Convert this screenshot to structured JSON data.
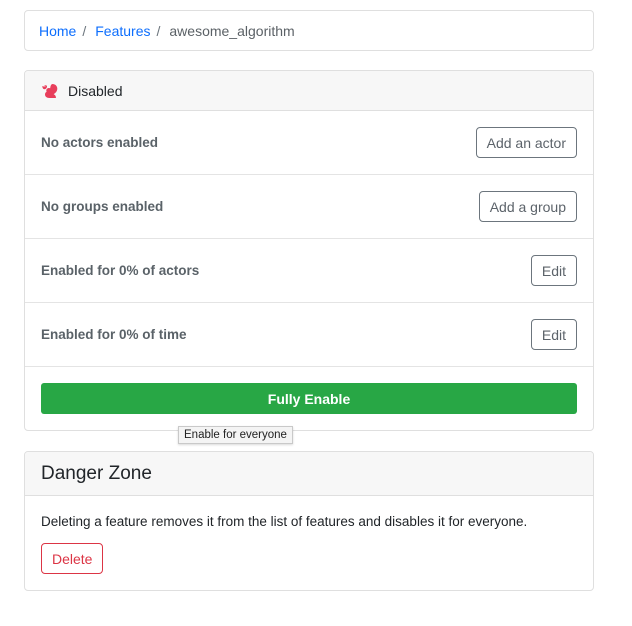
{
  "breadcrumb": {
    "home": "Home",
    "features": "Features",
    "current": "awesome_algorithm",
    "separator": "/"
  },
  "feature": {
    "status_icon": "squirrel-icon",
    "status_color": "#e83e5b",
    "status": "Disabled",
    "rows": [
      {
        "label": "No actors enabled",
        "button": "Add an actor"
      },
      {
        "label": "No groups enabled",
        "button": "Add a group"
      },
      {
        "label": "Enabled for 0% of actors",
        "button": "Edit"
      },
      {
        "label": "Enabled for 0% of time",
        "button": "Edit"
      }
    ],
    "fully_enable": "Fully Enable",
    "fully_enable_color": "#28a745",
    "tooltip": "Enable for everyone"
  },
  "danger": {
    "title": "Danger Zone",
    "description": "Deleting a feature removes it from the list of features and disables it for everyone.",
    "delete": "Delete",
    "delete_color": "#dc3545"
  }
}
